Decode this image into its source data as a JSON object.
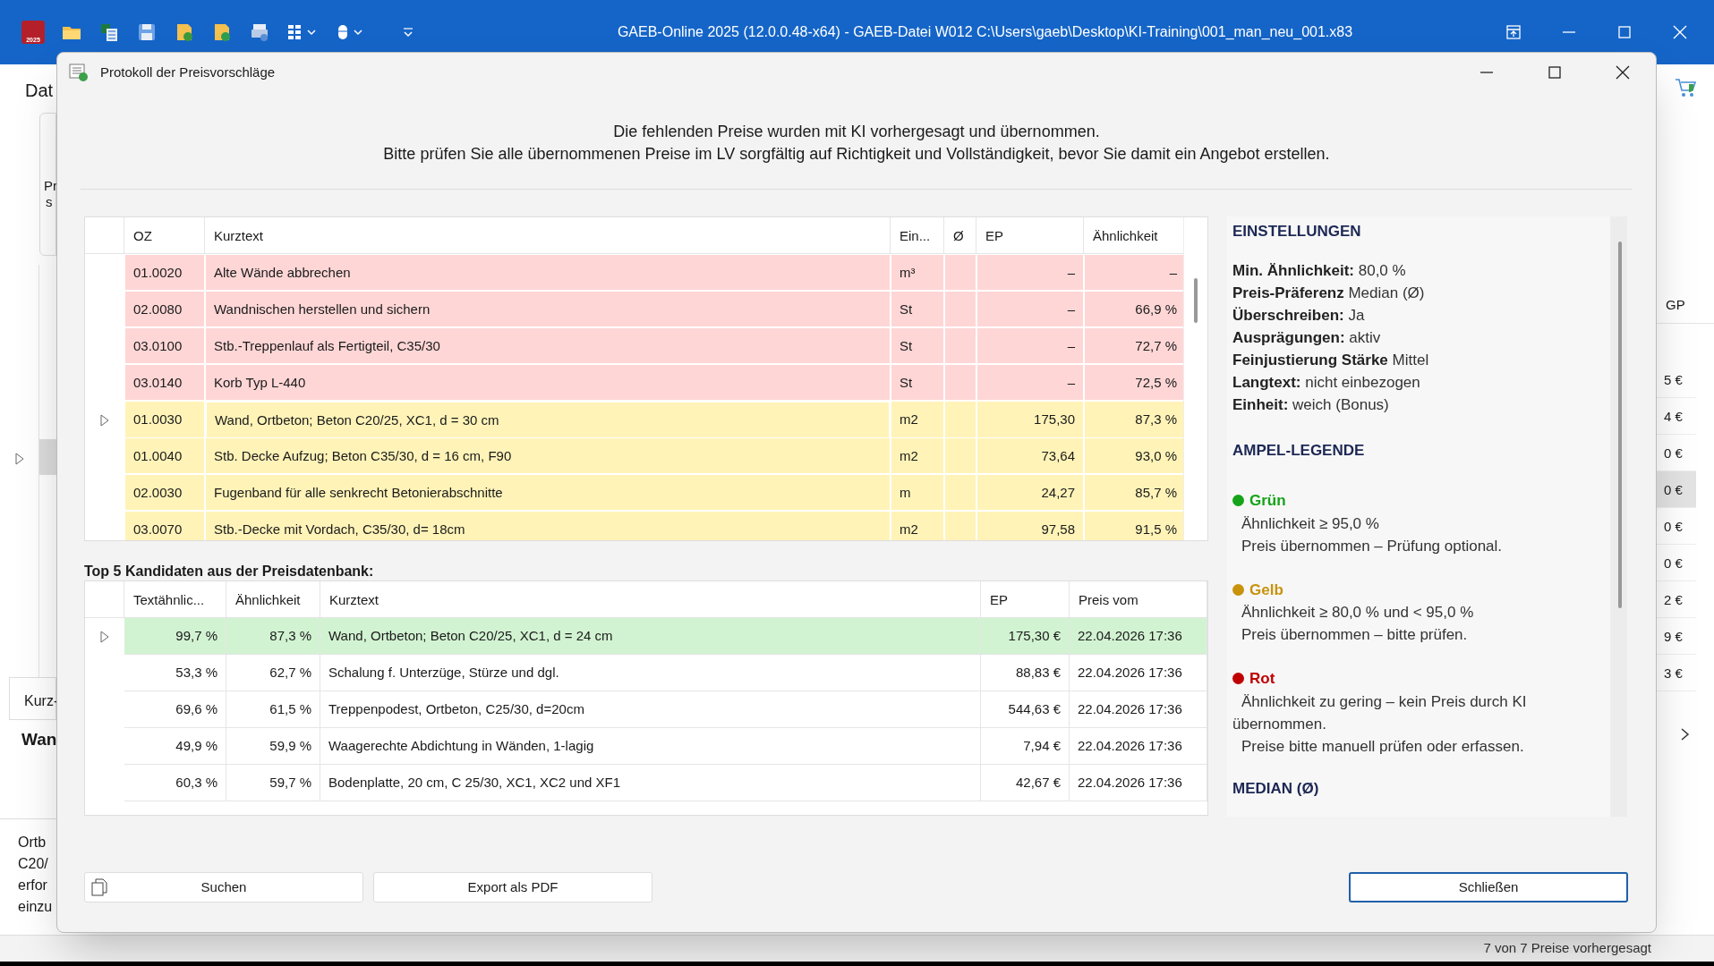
{
  "app": {
    "logo_text": "2025",
    "title": "GAEB-Online 2025 (12.0.0.48-x64) - GAEB-Datei  W012 C:\\Users\\gaeb\\Desktop\\KI-Training\\001_man_neu_001.x83"
  },
  "background": {
    "ribbon_tab": "Dat",
    "ribbon_label_lines": [
      "Pr",
      "s"
    ],
    "grid_header": "GP",
    "grid_values": [
      "5 €",
      "4 €",
      "0 €",
      "0 €",
      "0 €",
      "0 €",
      "2 €",
      "9 €",
      "3 €"
    ],
    "detail_tab": "Kurz-",
    "detail_title": "Wan",
    "longtext_lines": [
      "Ortb",
      "C20/",
      "erfor",
      "einzu"
    ],
    "status": "7 von 7 Preise vorhergesagt"
  },
  "dialog": {
    "title": "Protokoll der Preisvorschläge",
    "message_lines": [
      "Die fehlenden Preise wurden mit KI vorhergesagt und übernommen.",
      "Bitte prüfen Sie alle übernommenen Preise im LV sorgfältig auf Richtigkeit und Vollständigkeit, bevor Sie damit ein Angebot erstellen."
    ],
    "positions": {
      "columns": [
        "OZ",
        "Kurztext",
        "Ein...",
        "Ø",
        "EP",
        "Ähnlichkeit"
      ],
      "rows": [
        {
          "color": "#ffd6d6",
          "selected": false,
          "cells": [
            "01.0020",
            "Alte Wände abbrechen",
            "m³",
            "",
            "–",
            "–"
          ]
        },
        {
          "color": "#ffd6d6",
          "selected": false,
          "cells": [
            "02.0080",
            "Wandnischen herstellen und sichern",
            "St",
            "",
            "–",
            "66,9 %"
          ]
        },
        {
          "color": "#ffd6d6",
          "selected": false,
          "cells": [
            "03.0100",
            "Stb.-Treppenlauf als Fertigteil, C35/30",
            "St",
            "",
            "–",
            "72,7 %"
          ]
        },
        {
          "color": "#ffd6d6",
          "selected": false,
          "cells": [
            "03.0140",
            "Korb Typ L-440",
            "St",
            "",
            "–",
            "72,5 %"
          ]
        },
        {
          "color": "#fff3b8",
          "selected": true,
          "cells": [
            "01.0030",
            "Wand, Ortbeton; Beton C20/25, XC1, d = 30 cm",
            "m2",
            "",
            "175,30",
            "87,3 %"
          ]
        },
        {
          "color": "#fff3b8",
          "selected": false,
          "cells": [
            "01.0040",
            "Stb. Decke Aufzug; Beton C35/30, d = 16 cm, F90",
            "m2",
            "",
            "73,64",
            "93,0 %"
          ]
        },
        {
          "color": "#fff3b8",
          "selected": false,
          "cells": [
            "02.0030",
            "Fugenband für alle senkrecht Betonierabschnitte",
            "m",
            "",
            "24,27",
            "85,7 %"
          ]
        },
        {
          "color": "#fff3b8",
          "selected": false,
          "cells": [
            "03.0070",
            "Stb.-Decke mit Vordach, C35/30, d= 18cm",
            "m2",
            "",
            "97,58",
            "91,5 %"
          ]
        }
      ]
    },
    "candidates": {
      "title": "Top 5 Kandidaten aus der Preisdatenbank:",
      "columns": [
        "Textähnlic...",
        "Ähnlichkeit",
        "Kurztext",
        "EP",
        "Preis vom"
      ],
      "rows": [
        {
          "selected": true,
          "cells": [
            "99,7 %",
            "87,3 %",
            "Wand, Ortbeton; Beton C20/25, XC1, d = 24 cm",
            "175,30 €",
            "22.04.2026 17:36"
          ]
        },
        {
          "selected": false,
          "cells": [
            "53,3 %",
            "62,7 %",
            "Schalung f. Unterzüge, Stürze und dgl.",
            "88,83 €",
            "22.04.2026 17:36"
          ]
        },
        {
          "selected": false,
          "cells": [
            "69,6 %",
            "61,5 %",
            "Treppenpodest, Ortbeton, C25/30, d=20cm",
            "544,63 €",
            "22.04.2026 17:36"
          ]
        },
        {
          "selected": false,
          "cells": [
            "49,9 %",
            "59,9 %",
            "Waagerechte Abdichtung in Wänden, 1-lagig",
            "7,94 €",
            "22.04.2026 17:36"
          ]
        },
        {
          "selected": false,
          "cells": [
            "60,3 %",
            "59,7 %",
            "Bodenplatte, 20 cm, C 25/30, XC1, XC2 und XF1",
            "42,67 €",
            "22.04.2026 17:36"
          ]
        }
      ]
    },
    "settings": {
      "heading": "EINSTELLUNGEN",
      "items": [
        {
          "label": "Min. Ähnlichkeit:",
          "value": "80,0 %"
        },
        {
          "label": "Preis-Präferenz",
          "value": "Median (Ø)"
        },
        {
          "label": "Überschreiben:",
          "value": "Ja"
        },
        {
          "label": "Ausprägungen:",
          "value": "aktiv"
        },
        {
          "label": "Feinjustierung Stärke",
          "value": "Mittel"
        },
        {
          "label": "Langtext:",
          "value": "nicht einbezogen"
        },
        {
          "label": "Einheit:",
          "value": "weich (Bonus)"
        }
      ],
      "legend_heading": "AMPEL-LEGENDE",
      "legend": [
        {
          "label": "Grün",
          "color": "#16a31a",
          "lines": [
            "Ähnlichkeit ≥ 95,0 %",
            "Preis übernommen – Prüfung optional."
          ]
        },
        {
          "label": "Gelb",
          "color": "#c8920c",
          "lines": [
            "Ähnlichkeit ≥ 80,0 % und < 95,0 %",
            "Preis übernommen – bitte prüfen."
          ]
        },
        {
          "label": "Rot",
          "color": "#c00000",
          "lines": [
            "Ähnlichkeit zu gering – kein Preis durch KI übernommen.",
            "Preise bitte manuell prüfen oder erfassen."
          ]
        }
      ],
      "median_heading": "MEDIAN  (Ø)"
    },
    "buttons": {
      "search": "Suchen",
      "export": "Export als PDF",
      "close": "Schließen"
    }
  }
}
